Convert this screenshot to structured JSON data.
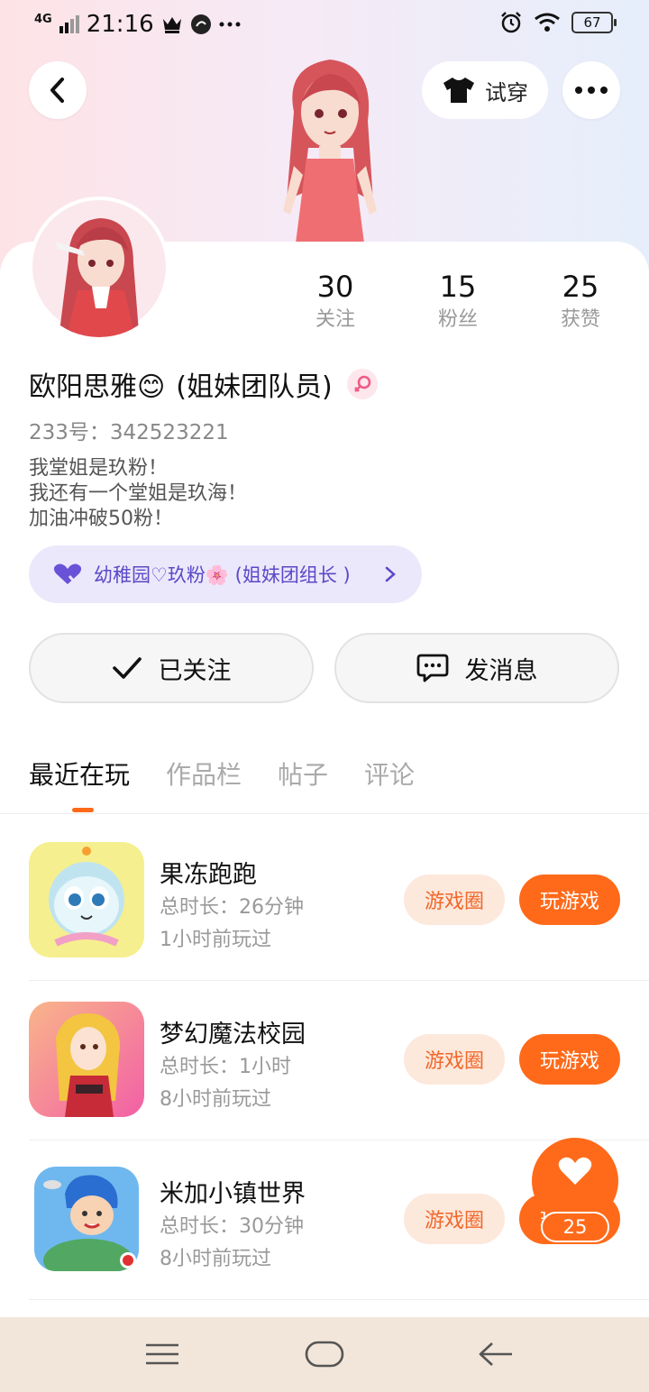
{
  "status": {
    "network": "4G",
    "time": "21:16",
    "battery": "67"
  },
  "header": {
    "try_on_label": "试穿"
  },
  "stats": [
    {
      "value": "30",
      "label": "关注"
    },
    {
      "value": "15",
      "label": "粉丝"
    },
    {
      "value": "25",
      "label": "获赞"
    }
  ],
  "profile": {
    "name": "欧阳思雅😊",
    "role": "(姐妹团队员)",
    "uid": "233号：342523221",
    "bio": "我堂姐是玖粉！\n 我还有一个堂姐是玖海！\n加油冲破50粉！",
    "group": "幼稚园♡玖粉🌸 (姐妹团组长 )"
  },
  "actions": {
    "followed": "已关注",
    "message": "发消息"
  },
  "tabs": [
    "最近在玩",
    "作品栏",
    "帖子",
    "评论"
  ],
  "games": [
    {
      "name": "果冻跑跑",
      "duration": "总时长：26分钟",
      "last_played": "1小时前玩过",
      "circle_label": "游戏圈",
      "play_label": "玩游戏"
    },
    {
      "name": "梦幻魔法校园",
      "duration": "总时长：1小时",
      "last_played": "8小时前玩过",
      "circle_label": "游戏圈",
      "play_label": "玩游戏"
    },
    {
      "name": "米加小镇世界",
      "duration": "总时长：30分钟",
      "last_played": "8小时前玩过",
      "circle_label": "游戏圈",
      "play_label": "玩游戏"
    }
  ],
  "like": {
    "count": "25"
  },
  "colors": {
    "accent": "#ff6a1a",
    "accent_light": "#fde8dc",
    "group_bg": "#ece8fb",
    "group_text": "#5a49c8"
  }
}
